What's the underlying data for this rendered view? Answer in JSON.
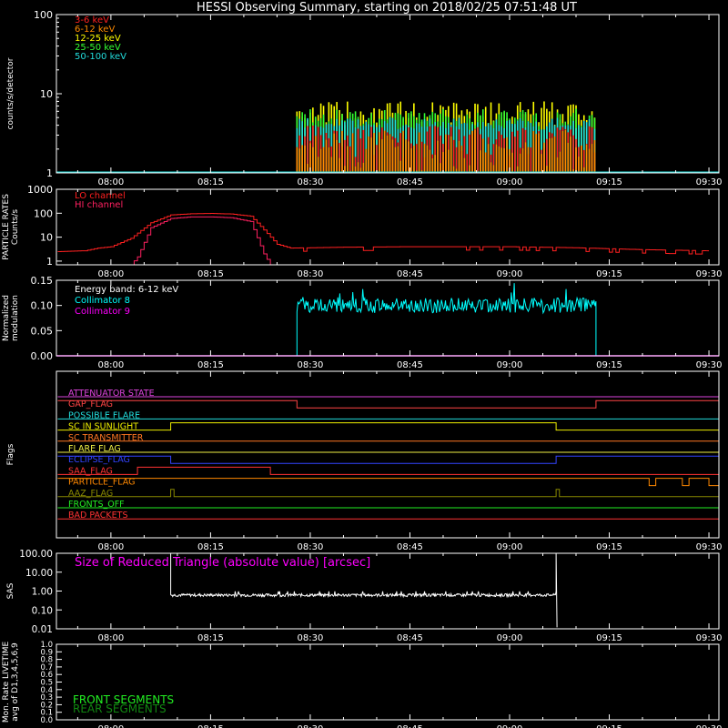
{
  "title": "HESSI Observing Summary, starting on 2018/02/25 07:51:48 UT",
  "time_ticks": [
    "08:00",
    "08:15",
    "08:30",
    "08:45",
    "09:00",
    "09:15",
    "09:30"
  ],
  "colors": {
    "bg": "#000000",
    "axis": "#ffffff",
    "e3_6": "#ff2020",
    "e6_12": "#ff8a00",
    "e12_25": "#ffff00",
    "e25_50": "#33ff33",
    "e50_100": "#22dddd",
    "lo": "#ff2020",
    "hi": "#ff2060",
    "coll8": "#00ffff",
    "coll9": "#ff00ff",
    "front": "#22ee22",
    "rear": "#118811"
  },
  "chart_data": [
    {
      "id": "count-rates",
      "type": "bar",
      "ylabel": "counts/s/detector",
      "y_scale": "log",
      "ylim": [
        1,
        100
      ],
      "y_ticks": [
        "1",
        "10",
        "100"
      ],
      "legend_placement": "top-left",
      "series": [
        {
          "name": "3-6 keV",
          "range_min": 1.5,
          "range_max": 4.0
        },
        {
          "name": "6-12 keV",
          "range_min": 1.0,
          "range_max": 3.5
        },
        {
          "name": "12-25 keV",
          "range_min": 4.0,
          "range_max": 8.0
        },
        {
          "name": "25-50 keV",
          "range_min": 3.5,
          "range_max": 6.5
        },
        {
          "name": "50-100 keV",
          "range_min": 3.5,
          "range_max": 5.0
        }
      ],
      "active_interval": [
        "08:28",
        "09:13"
      ],
      "baseline": 1
    },
    {
      "id": "particle-rates",
      "type": "line",
      "ylabel": "PARTICLE RATES Counts/s",
      "y_scale": "log",
      "ylim": [
        0.7,
        1000
      ],
      "y_ticks": [
        "1",
        "10",
        "100",
        "1000"
      ],
      "legend_placement": "top-left",
      "series": [
        {
          "name": "LO channel",
          "points": [
            [
              "07:52",
              2.5
            ],
            [
              "07:56",
              2.7
            ],
            [
              "07:58",
              3.5
            ],
            [
              "08:00",
              4
            ],
            [
              "08:03",
              9
            ],
            [
              "08:06",
              40
            ],
            [
              "08:09",
              85
            ],
            [
              "08:12",
              95
            ],
            [
              "08:15",
              98
            ],
            [
              "08:18",
              93
            ],
            [
              "08:21",
              75
            ],
            [
              "08:23",
              20
            ],
            [
              "08:25",
              5
            ],
            [
              "08:27",
              3.5
            ],
            [
              "08:35",
              3.8
            ],
            [
              "08:45",
              4
            ],
            [
              "09:00",
              4
            ],
            [
              "09:10",
              3.6
            ],
            [
              "09:20",
              3
            ],
            [
              "09:30",
              2.7
            ]
          ]
        },
        {
          "name": "HI channel",
          "points": [
            [
              "07:52",
              0.7
            ],
            [
              "08:03",
              0.7
            ],
            [
              "08:04",
              1.5
            ],
            [
              "08:06",
              25
            ],
            [
              "08:09",
              60
            ],
            [
              "08:12",
              70
            ],
            [
              "08:15",
              70
            ],
            [
              "08:18",
              65
            ],
            [
              "08:21",
              45
            ],
            [
              "08:23",
              2
            ],
            [
              "08:24",
              0.7
            ],
            [
              "09:30",
              0.7
            ]
          ]
        }
      ]
    },
    {
      "id": "modulation",
      "type": "bar",
      "ylabel": "Normalized modulation",
      "ylim": [
        0,
        0.15
      ],
      "y_ticks": [
        "0.00",
        "0.05",
        "0.10",
        "0.15"
      ],
      "annotation": "Energy band: 6-12 keV",
      "legend_placement": "top-left",
      "series": [
        {
          "name": "Collimator 8",
          "typical": 0.1,
          "range_min": 0.085,
          "range_max": 0.15,
          "interval": [
            "08:28",
            "09:13"
          ]
        },
        {
          "name": "Collimator 9",
          "value": 0
        }
      ]
    },
    {
      "id": "flags",
      "type": "line",
      "ylabel": "Flags",
      "flags": [
        {
          "name": "ATTENUATOR STATE",
          "color": "#dd44dd",
          "steps": [
            [
              "07:52",
              0
            ]
          ]
        },
        {
          "name": "GAP_FLAG",
          "color": "#ff4444",
          "steps": [
            [
              "07:52",
              1
            ],
            [
              "08:28",
              0
            ],
            [
              "09:13",
              1
            ]
          ]
        },
        {
          "name": "POSSIBLE FLARE",
          "color": "#22dddd",
          "steps": [
            [
              "07:52",
              0
            ]
          ]
        },
        {
          "name": "SC IN SUNLIGHT",
          "color": "#eeee00",
          "steps": [
            [
              "07:52",
              0
            ],
            [
              "08:09",
              1
            ],
            [
              "09:07",
              0
            ]
          ]
        },
        {
          "name": "SC TRANSMITTER",
          "color": "#ff7722",
          "steps": [
            [
              "07:52",
              0
            ]
          ]
        },
        {
          "name": "FLARE FLAG",
          "color": "#eeee44",
          "steps": [
            [
              "07:52",
              0
            ]
          ]
        },
        {
          "name": "ECLIPSE_FLAG",
          "color": "#3344ff",
          "steps": [
            [
              "07:52",
              1
            ],
            [
              "08:09",
              0
            ],
            [
              "09:07",
              1
            ]
          ]
        },
        {
          "name": "SAA_FLAG",
          "color": "#ff3333",
          "steps": [
            [
              "07:52",
              0
            ],
            [
              "08:04",
              1
            ],
            [
              "08:24",
              0
            ]
          ]
        },
        {
          "name": "PARTICLE_FLAG",
          "color": "#ff8800",
          "steps": [
            [
              "07:52",
              1
            ],
            [
              "09:21",
              0
            ],
            [
              "09:22",
              1
            ],
            [
              "09:26",
              0
            ],
            [
              "09:27",
              1
            ],
            [
              "09:30",
              0
            ]
          ]
        },
        {
          "name": "AAZ_FLAG",
          "color": "#888800",
          "steps": [
            [
              "07:52",
              0
            ],
            [
              "08:09",
              1
            ],
            [
              "08:09.5",
              0
            ],
            [
              "09:07",
              1
            ],
            [
              "09:07.5",
              0
            ]
          ]
        },
        {
          "name": "FRONTS_OFF",
          "color": "#22ee22",
          "steps": [
            [
              "07:52",
              0
            ]
          ]
        },
        {
          "name": "BAD PACKETS",
          "color": "#ff3333",
          "steps": [
            [
              "07:52",
              0
            ]
          ]
        }
      ]
    },
    {
      "id": "sas",
      "type": "line",
      "ylabel": "SAS",
      "y_scale": "log",
      "ylim": [
        0.01,
        100
      ],
      "y_ticks": [
        "0.01",
        "0.10",
        "1.00",
        "10.00",
        "100.00"
      ],
      "series": [
        {
          "name": "Size of Reduced Triangle (absolute value) [arcsec]",
          "typical": 0.6,
          "interval": [
            "08:09",
            "09:07"
          ],
          "spikes_to": 100
        }
      ]
    },
    {
      "id": "livetime",
      "type": "line",
      "ylabel": "Mon. Rate LIVETIME avg of D1,3,4,5,6,9",
      "ylim": [
        0,
        1.0
      ],
      "y_ticks": [
        "0.0",
        "0.1",
        "0.2",
        "0.3",
        "0.4",
        "0.5",
        "0.6",
        "0.7",
        "0.8",
        "0.9",
        "1.0"
      ],
      "legend_placement": "bottom-left",
      "series": [
        {
          "name": "FRONT SEGMENTS"
        },
        {
          "name": "REAR SEGMENTS"
        }
      ]
    }
  ]
}
